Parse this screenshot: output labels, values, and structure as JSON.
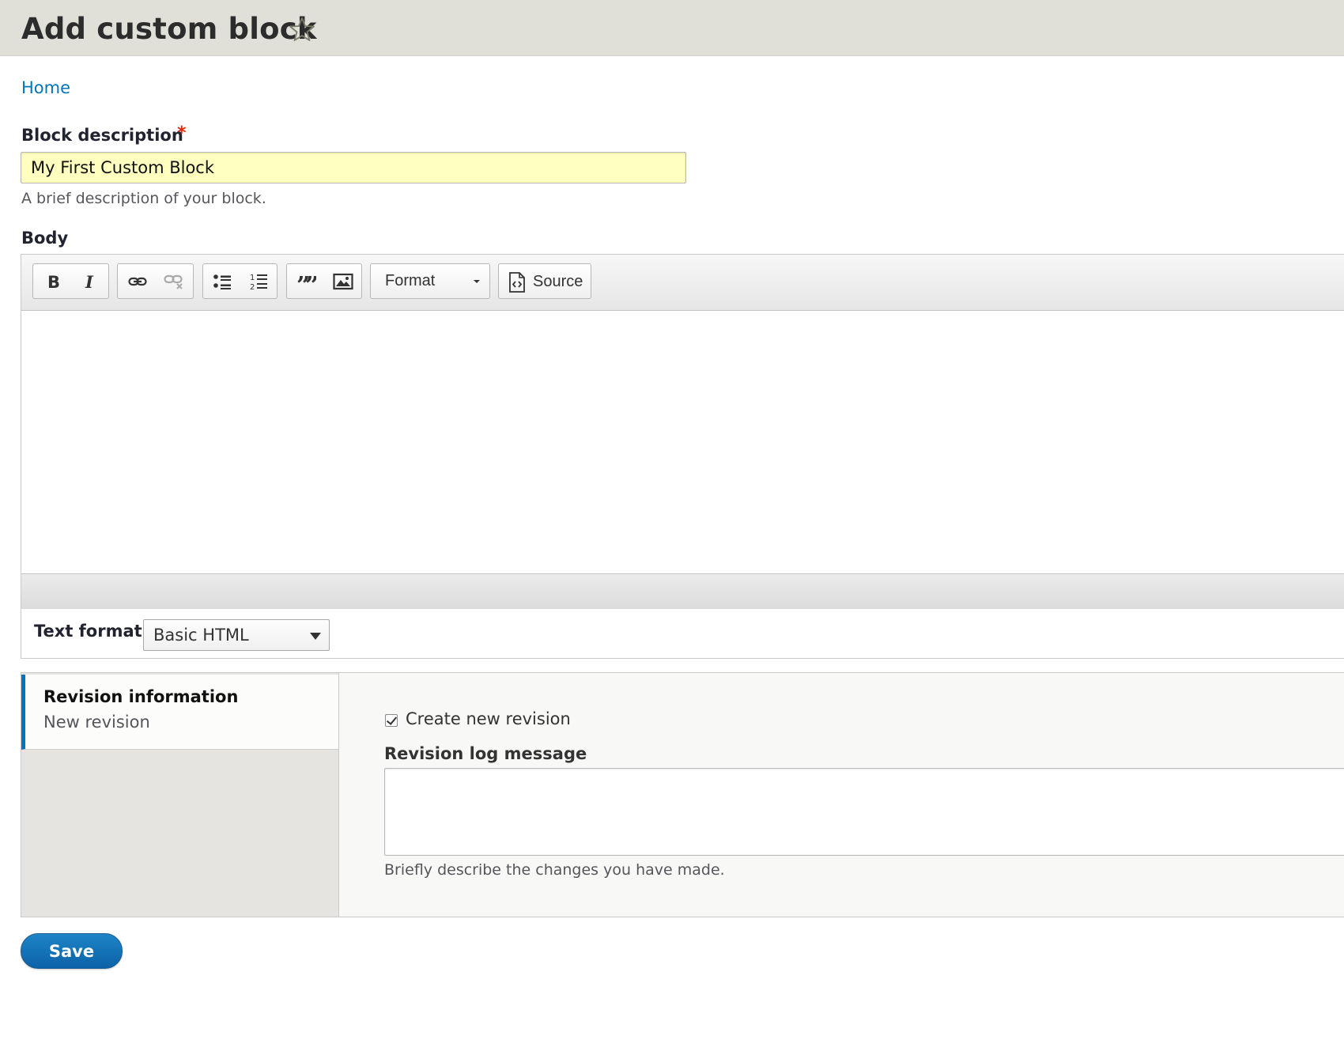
{
  "header": {
    "title": "Add custom block",
    "shortcut_icon": "star-outline-icon"
  },
  "breadcrumb": {
    "home": "Home"
  },
  "form": {
    "block_description": {
      "label": "Block description",
      "required_marker": "*",
      "value": "My First Custom Block",
      "help": "A brief description of your block."
    },
    "body": {
      "label": "Body",
      "toolbar": {
        "bold_icon": "bold-icon",
        "italic_icon": "italic-icon",
        "link_icon": "link-icon",
        "unlink_icon": "unlink-icon",
        "bulleted_list_icon": "bulleted-list-icon",
        "numbered_list_icon": "numbered-list-icon",
        "blockquote_icon": "blockquote-icon",
        "image_icon": "image-icon",
        "format_label": "Format",
        "source_label": "Source"
      },
      "text_format": {
        "label": "Text format",
        "selected": "Basic HTML"
      }
    },
    "revision": {
      "tab_title": "Revision information",
      "tab_summary": "New revision",
      "create_label": "Create new revision",
      "create_checked": true,
      "log_label": "Revision log message",
      "log_value": "",
      "log_help": "Briefly describe the changes you have made."
    },
    "save_label": "Save"
  }
}
